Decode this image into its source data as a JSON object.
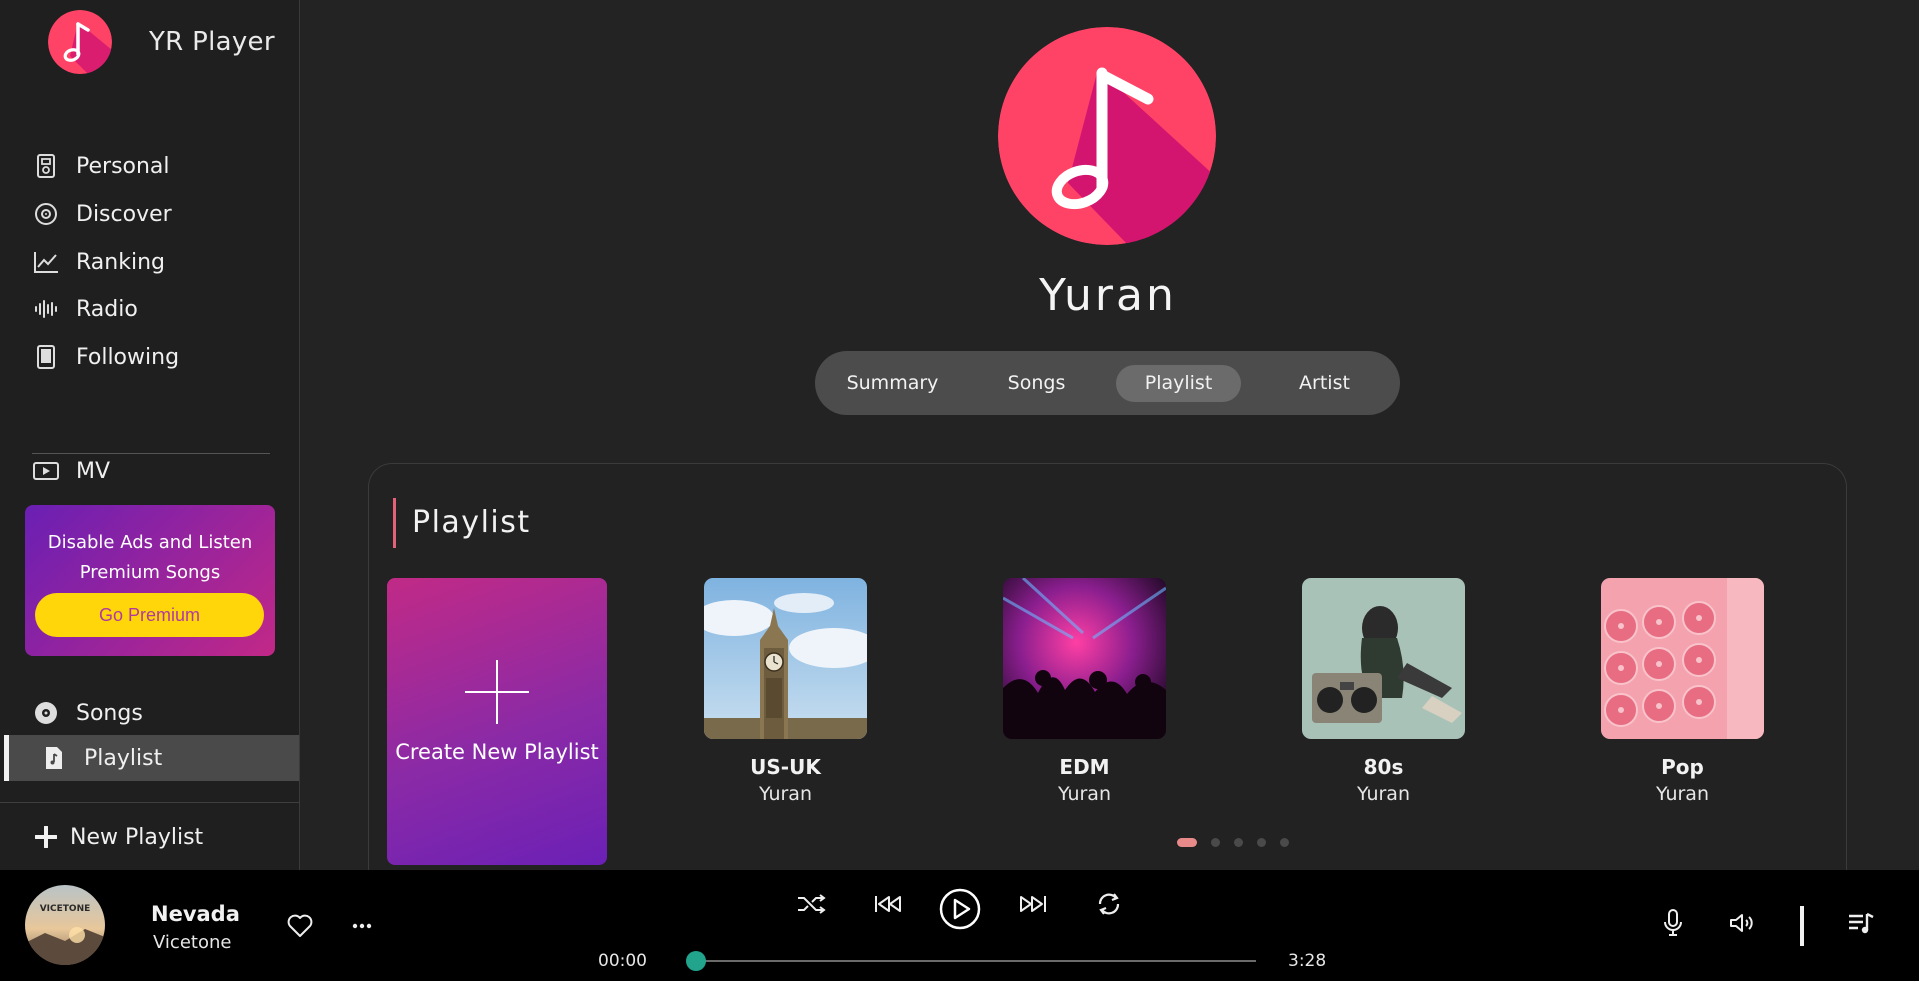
{
  "app": {
    "name": "YR Player"
  },
  "sidebar": {
    "items": [
      {
        "label": "Personal",
        "icon": "ipod-icon"
      },
      {
        "label": "Discover",
        "icon": "disc-icon"
      },
      {
        "label": "Ranking",
        "icon": "chart-line-icon"
      },
      {
        "label": "Radio",
        "icon": "soundwave-icon"
      },
      {
        "label": "Following",
        "icon": "tablet-icon"
      }
    ],
    "mv_label": "MV",
    "premium": {
      "text": "Disable Ads and Listen Premium Songs",
      "button": "Go Premium"
    },
    "library": [
      {
        "label": "Songs",
        "icon": "disc-icon"
      },
      {
        "label": "Playlist",
        "icon": "music-file-icon",
        "active": true
      }
    ],
    "new_playlist": "New Playlist"
  },
  "profile": {
    "name": "Yuran"
  },
  "tabs": [
    {
      "label": "Summary"
    },
    {
      "label": "Songs"
    },
    {
      "label": "Playlist",
      "active": true
    },
    {
      "label": "Artist"
    }
  ],
  "playlist_section": {
    "title": "Playlist",
    "create_label": "Create New Playlist",
    "playlists": [
      {
        "name": "US-UK",
        "owner": "Yuran"
      },
      {
        "name": "EDM",
        "owner": "Yuran"
      },
      {
        "name": "80s",
        "owner": "Yuran"
      },
      {
        "name": "Pop",
        "owner": "Yuran"
      }
    ],
    "pagination": {
      "pages": 5,
      "current": 1
    }
  },
  "player": {
    "title": "Nevada",
    "artist": "Vicetone",
    "art_text": "VICETONE",
    "current_time": "00:00",
    "duration": "3:28",
    "progress": 0.01
  },
  "colors": {
    "accent": "#21a38c",
    "brand_pink": "#ff4367",
    "premium_yellow": "#ffd60a",
    "title_accent": "#e3627a"
  }
}
